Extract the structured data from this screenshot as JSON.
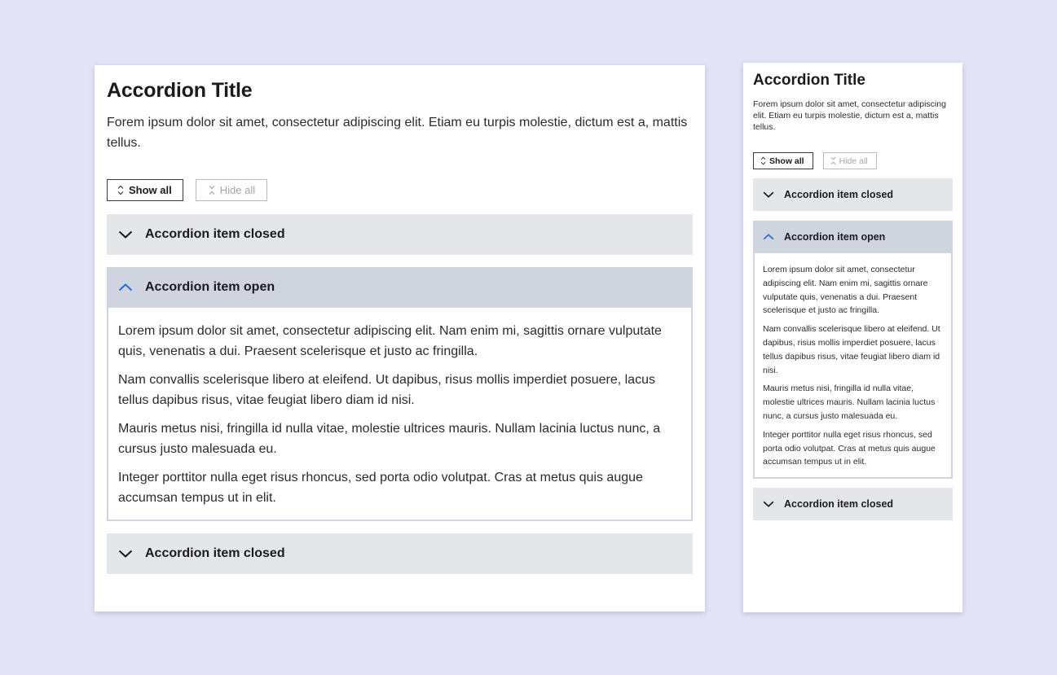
{
  "colors": {
    "page_background": "#e3e3f7",
    "card_background": "#ffffff",
    "header_closed": "#e5e6ea",
    "header_open": "#d0d4de",
    "open_chevron": "#1f6fd6",
    "text": "#1b1b1f"
  },
  "large": {
    "title": "Accordion Title",
    "intro": "Forem ipsum dolor sit amet, consectetur adipiscing elit. Etiam eu turpis molestie, dictum est a, mattis tellus.",
    "show_all": "Show all",
    "hide_all": "Hide all",
    "items": [
      {
        "label": "Accordion item closed",
        "state": "closed"
      },
      {
        "label": "Accordion item open",
        "state": "open",
        "paragraphs": [
          "Lorem ipsum dolor sit amet, consectetur adipiscing elit. Nam enim mi, sagittis ornare vulputate quis, venenatis a dui. Praesent scelerisque et justo ac fringilla.",
          "Nam convallis scelerisque libero at eleifend. Ut dapibus, risus mollis imperdiet posuere, lacus tellus dapibus risus, vitae feugiat libero diam id nisi.",
          "Mauris metus nisi, fringilla id nulla vitae, molestie ultrices mauris. Nullam lacinia luctus nunc, a cursus justo malesuada eu.",
          "Integer porttitor nulla eget risus rhoncus, sed porta odio volutpat. Cras at metus quis augue accumsan tempus ut in elit."
        ]
      },
      {
        "label": "Accordion item closed",
        "state": "closed"
      }
    ]
  },
  "small": {
    "title": "Accordion Title",
    "intro": "Forem ipsum dolor sit amet, consectetur adipiscing elit. Etiam eu turpis molestie, dictum est a, mattis tellus.",
    "show_all": "Show all",
    "hide_all": "Hide all",
    "items": [
      {
        "label": "Accordion item closed",
        "state": "closed"
      },
      {
        "label": "Accordion item open",
        "state": "open",
        "paragraphs": [
          "Lorem ipsum dolor sit amet, consectetur adipiscing elit. Nam enim mi, sagittis ornare vulputate quis, venenatis a dui. Praesent scelerisque et justo ac fringilla.",
          "Nam convallis scelerisque libero at eleifend. Ut dapibus, risus mollis imperdiet posuere, lacus tellus dapibus risus, vitae feugiat libero diam id nisi.",
          "Mauris metus nisi, fringilla id nulla vitae, molestie ultrices mauris. Nullam lacinia luctus nunc, a cursus justo malesuada eu.",
          "Integer porttitor nulla eget risus rhoncus, sed porta odio volutpat. Cras at metus quis augue accumsan tempus ut in elit."
        ]
      },
      {
        "label": "Accordion item closed",
        "state": "closed"
      }
    ]
  }
}
